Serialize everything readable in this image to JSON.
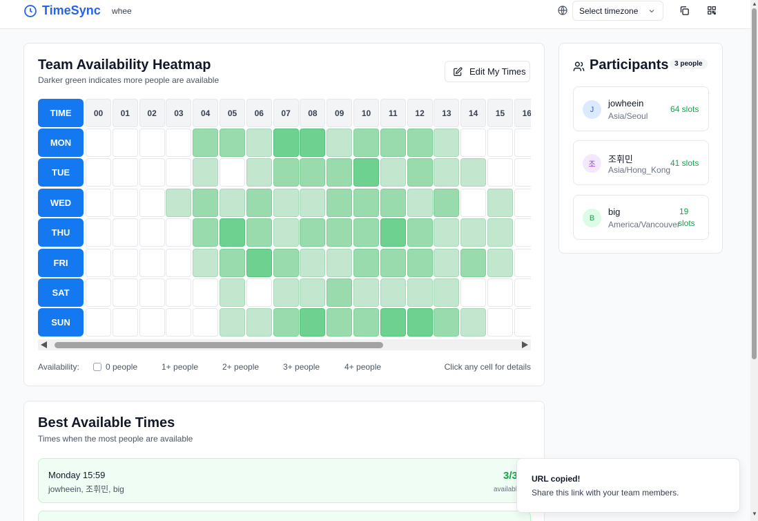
{
  "header": {
    "app_title": "TimeSync",
    "room_name": "whee",
    "timezone_select": "Select timezone"
  },
  "heatmap": {
    "title": "Team Availability Heatmap",
    "subtitle": "Darker green indicates more people are available",
    "edit_button": "Edit My Times",
    "corner_label": "TIME",
    "hours": [
      "00",
      "01",
      "02",
      "03",
      "04",
      "05",
      "06",
      "07",
      "08",
      "09",
      "10",
      "11",
      "12",
      "13",
      "14",
      "15",
      "16"
    ],
    "days": [
      "MON",
      "TUE",
      "WED",
      "THU",
      "FRI",
      "SAT",
      "SUN"
    ],
    "levels": [
      [
        0,
        0,
        0,
        0,
        2,
        2,
        1,
        3,
        3,
        1,
        2,
        2,
        2,
        1,
        0,
        0,
        0
      ],
      [
        0,
        0,
        0,
        0,
        1,
        0,
        1,
        2,
        2,
        2,
        3,
        1,
        2,
        1,
        1,
        0,
        0
      ],
      [
        0,
        0,
        0,
        1,
        2,
        1,
        2,
        1,
        1,
        2,
        2,
        2,
        1,
        2,
        0,
        1,
        0
      ],
      [
        0,
        0,
        0,
        0,
        2,
        3,
        2,
        1,
        2,
        2,
        2,
        3,
        2,
        1,
        1,
        1,
        0
      ],
      [
        0,
        0,
        0,
        0,
        1,
        2,
        3,
        2,
        1,
        1,
        2,
        2,
        2,
        1,
        2,
        1,
        0
      ],
      [
        0,
        0,
        0,
        0,
        0,
        1,
        0,
        1,
        1,
        2,
        1,
        1,
        1,
        1,
        0,
        0,
        0
      ],
      [
        0,
        0,
        0,
        0,
        0,
        1,
        1,
        2,
        3,
        2,
        2,
        3,
        3,
        2,
        1,
        0,
        0
      ]
    ],
    "legend_label": "Availability:",
    "legend_items": [
      "0 people",
      "1+ people",
      "2+ people",
      "3+ people",
      "4+ people"
    ],
    "hint": "Click any cell for details",
    "colors": {
      "level0": "#ffffff",
      "level1": "#c3e6cf",
      "level2": "#9adbae",
      "level3": "#6fd190",
      "day_header": "#1479f0"
    }
  },
  "participants": {
    "title": "Participants",
    "count_badge": "3 people",
    "list": [
      {
        "initial": "J",
        "name": "jowheein",
        "timezone": "Asia/Seoul",
        "slots": "64 slots"
      },
      {
        "initial": "조",
        "name": "조휘민",
        "timezone": "Asia/Hong_Kong",
        "slots": "41 slots"
      },
      {
        "initial": "B",
        "name": "big",
        "timezone": "America/Vancouver",
        "slots_num": "19",
        "slots_word": "slots"
      }
    ]
  },
  "best_times": {
    "title": "Best Available Times",
    "subtitle": "Times when the most people are available",
    "items": [
      {
        "time": "Monday 15:59",
        "people": "jowheein, 조휘민, big",
        "count": "3/3",
        "label": "available"
      }
    ]
  },
  "toast": {
    "title": "URL copied!",
    "description": "Share this link with your team members."
  }
}
